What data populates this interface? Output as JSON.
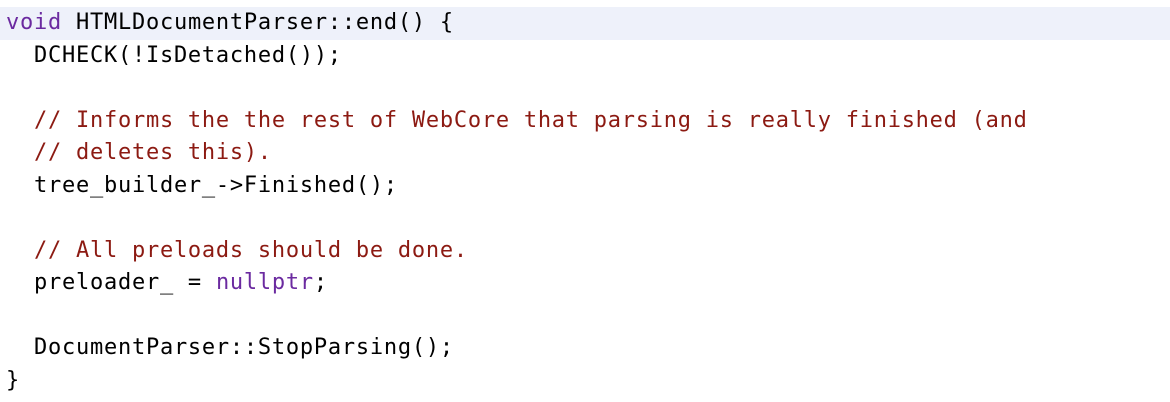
{
  "code": {
    "language": "C++",
    "lines": [
      {
        "highlighted": true,
        "tokens": [
          {
            "t": "void",
            "k": "keyword"
          },
          {
            "t": " HTMLDocumentParser::end() {",
            "k": "plain"
          }
        ]
      },
      {
        "tokens": [
          {
            "t": "  DCHECK(!IsDetached());",
            "k": "plain"
          }
        ]
      },
      {
        "tokens": []
      },
      {
        "tokens": [
          {
            "t": "  // Informs the the rest of WebCore that parsing is really finished (and",
            "k": "comment"
          }
        ]
      },
      {
        "tokens": [
          {
            "t": "  // deletes this).",
            "k": "comment"
          }
        ]
      },
      {
        "tokens": [
          {
            "t": "  tree_builder_->Finished();",
            "k": "plain"
          }
        ]
      },
      {
        "tokens": []
      },
      {
        "tokens": [
          {
            "t": "  // All preloads should be done.",
            "k": "comment"
          }
        ]
      },
      {
        "tokens": [
          {
            "t": "  preloader_ = ",
            "k": "plain"
          },
          {
            "t": "nullptr",
            "k": "keyword"
          },
          {
            "t": ";",
            "k": "plain"
          }
        ]
      },
      {
        "tokens": []
      },
      {
        "tokens": [
          {
            "t": "  DocumentParser::StopParsing();",
            "k": "plain"
          }
        ]
      },
      {
        "tokens": [
          {
            "t": "}",
            "k": "plain"
          }
        ]
      }
    ]
  },
  "colors": {
    "keyword": "#6b2aa0",
    "comment": "#8c1a12",
    "plain": "#000000",
    "highlight": "#eef1fa",
    "background": "#ffffff"
  }
}
